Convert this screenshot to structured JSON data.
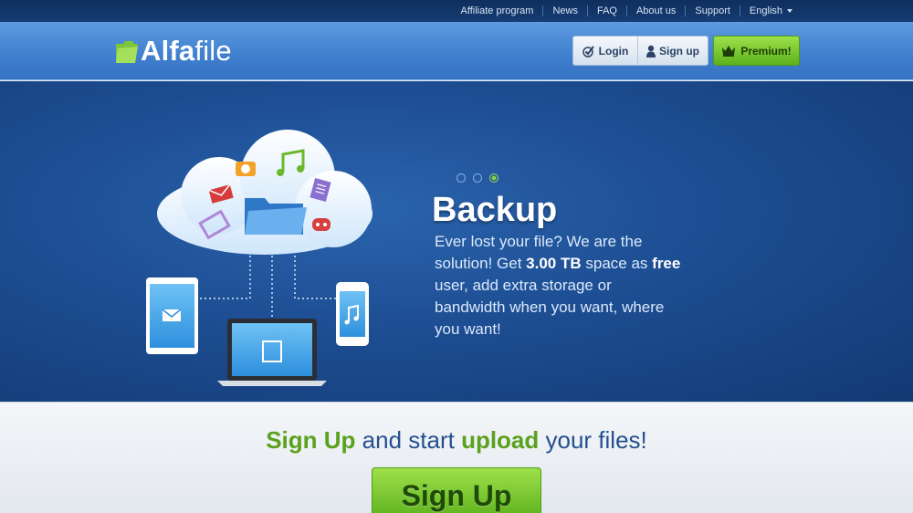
{
  "topnav": {
    "items": [
      "Affiliate program",
      "News",
      "FAQ",
      "About us",
      "Support"
    ],
    "language": "English"
  },
  "header": {
    "logo_bold": "Alfa",
    "logo_light": "file",
    "login_label": "Login",
    "signup_label": "Sign up",
    "premium_label": "Premium!"
  },
  "hero": {
    "title": "Backup",
    "text_1": "Ever lost your file? We are the solution! Get ",
    "text_2": "3.00 TB",
    "text_3": " space as ",
    "text_4": "free",
    "text_5": " user, add extra storage or bandwidth when you want, where you want!",
    "slides": 3,
    "active_slide": 3
  },
  "band": {
    "part_1": "Sign Up",
    "part_2": " and start ",
    "part_3": "upload",
    "part_4": " your files!",
    "cta_label": "Sign Up"
  },
  "colors": {
    "accent_green": "#6bc02a",
    "brand_blue": "#1d4d92"
  }
}
